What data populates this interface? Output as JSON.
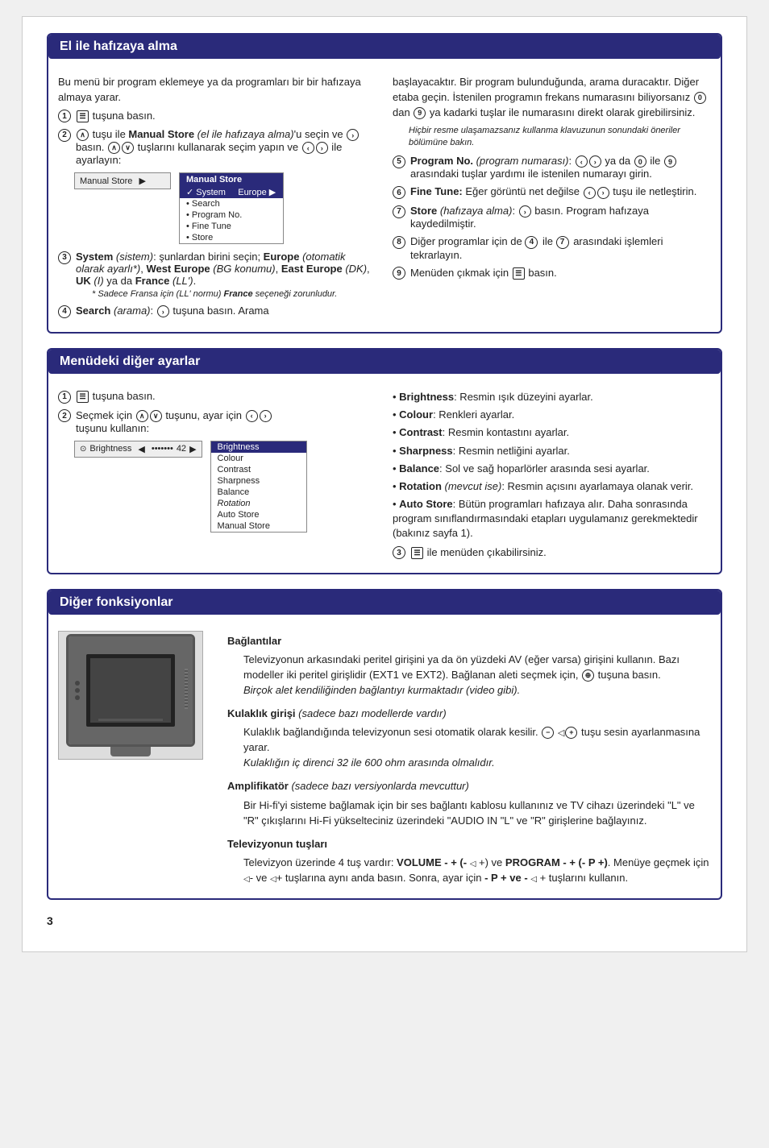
{
  "page": {
    "number": "3",
    "sections": {
      "section1": {
        "title": "El ile hafızaya alma",
        "col_left": {
          "intro": "Bu menü bir program eklemeye ya da programları bir bir hafızaya almaya yarar.",
          "step1": "tuşuna basın.",
          "step2_main": "tuşu ile Manual Store (el ile hafızaya alma)'u seçin ve",
          "step2_b": "basın.",
          "step2_c": "tuşlarını kullanarak seçim yapın ve",
          "step2_d": "ile ayarlayın:",
          "step3_main": "System (sistem):",
          "step3_options": "şunlardan birini seçin; Europe (otomatik olarak ayarlı*), West Europe (BG konumu), East Europe (DK), UK (I) ya da France (LL').",
          "step3_footnote": "* Sadece Fransa için (LL' normu) France seçeneği zorunludur.",
          "step4_main": "Search (arama):",
          "step4_detail": "tuşuna basın. Arama"
        },
        "col_right": {
          "para1": "başlayacaktır. Bir program bulunduğunda, arama duracaktır. Diğer etaba geçin. İstenilen programın frekans numarasını biliyorsanız",
          "para1b": "dan",
          "para1c": "ya kadarki tuşlar ile numarasını direkt olarak girebilirsiniz.",
          "para1_footnote": "Hiçbir resme ulaşamazsanız kullanma klavuzunun sonundaki öneriler bölümüne bakın.",
          "step5_main": "Program No. (program numarası):",
          "step5_detail": "ya da",
          "step5_detail2": "ile",
          "step5_detail3": "arasındaki tuşlar yardımı ile istenilen numarayı girin.",
          "step6_main": "Fine Tune:",
          "step6_detail": "Eğer görüntü net değilse",
          "step6_detail2": "tuşu ile netleştirin.",
          "step7_main": "Store (hafızaya alma):",
          "step7_detail": "basın. Program hafızaya kaydedilmiştir.",
          "step8_main": "Diğer programlar için de",
          "step8_detail": "ile",
          "step8_detail2": "arasındaki işlemleri tekrarlayın.",
          "step9_main": "Menüden çıkmak için",
          "step9_detail": "basın."
        },
        "menu": {
          "left_label": "Manual Store",
          "items": [
            "Manual Store",
            "✓ System",
            "• Search",
            "• Program No.",
            "• Fine Tune",
            "• Store"
          ],
          "system_value": "Europe ▶"
        }
      },
      "section2": {
        "title": "Menüdeki diğer ayarlar",
        "col_left": {
          "step1": "tuşuna basın.",
          "step2_main": "Seçmek için",
          "step2_detail": "tuşunu, ayar için",
          "step2_detail2": "tuşunu kullanın:"
        },
        "col_right": {
          "items": [
            "Brightness: Resmin ışık düzeyini ayarlar.",
            "Colour: Renkleri ayarlar.",
            "Contrast: Resmin kontastını ayarlar.",
            "Sharpness: Resmin netliğini ayarlar.",
            "Balance: Sol ve sağ hoparlörler arasında sesi ayarlar.",
            "Rotation (mevcut ise): Resmin açısını ayarlamaya olanak verir.",
            "Auto Store: Bütün programları hafızaya alır. Daha sonrasında program sınıflandırmasındaki etapları uygulamanız gerekmektedir (bakınız sayfa 1).",
            "ile menüden çıkabilirsiniz."
          ],
          "item_labels": [
            "Brightness",
            "Colour",
            "Contrast",
            "Sharpness",
            "Balance",
            "Rotation (mevcut ise)",
            "Auto Store"
          ],
          "item_details": [
            "Resmin ışık düzeyini ayarlar.",
            "Renkleri ayarlar.",
            "Resmin kontastını ayarlar.",
            "Resmin netliğini ayarlar.",
            "Sol ve sağ hoparlörler arasında sesi ayarlar.",
            "Resmin açısını ayarlamaya olanak verir.",
            "Bütün programları hafızaya alır. Daha sonrasında program sınıflandırmasındaki etapları uygulamanız gerekmektedir (bakınız sayfa 1)."
          ],
          "step3": "ile menüden çıkabilirsiniz."
        },
        "menu": {
          "left_label": "Brightness",
          "left_value": "42",
          "items": [
            "Brightness",
            "Colour",
            "Contrast",
            "Sharpness",
            "Balance",
            "Rotation",
            "Auto Store",
            "Manual Store"
          ]
        }
      },
      "section3": {
        "title": "Diğer fonksiyonlar",
        "baglantilar": {
          "title": "Bağlantılar",
          "text": "Televizyonun arkasındaki peritel girişini ya da ön yüzdeki AV (eğer varsa) girişini kullanın. Bazı modeller iki peritel girişlidir (EXT1 ve EXT2). Bağlanan aleti seçmek için,",
          "text2": "tuşuna basın.",
          "footnote": "Birçok alet kendiliğinden bağlantıyı kurmaktadır (video gibi)."
        },
        "kulaklik": {
          "title": "Kulaklık girişi",
          "title_italic": "(sadece bazı modellerde vardır)",
          "text": "Kulaklık bağlandığında televizyonun sesi otomatik olarak kesilir.",
          "text2": "tuşu sesin ayarlanmasına yarar.",
          "footnote": "Kulaklığın iç direnci 32 ile 600 ohm arasında olmalıdır."
        },
        "amplifikator": {
          "title": "Amplifikatör",
          "title_italic": "(sadece bazı versiyonlarda mevcuttur)",
          "text": "Bir Hi-fi'yi sisteme bağlamak için bir ses bağlantı kablosu kullanınız ve TV cihazı üzerindeki \"L\" ve \"R\" çıkışlarını Hi-Fi yükselteciniz üzerindeki \"AUDIO IN \"L\" ve \"R\" girişlerine bağlayınız."
        },
        "televizyon_tuslari": {
          "title": "Televizyonun tuşları",
          "text": "Televizyon üzerinde 4 tuş vardır: VOLUME - + (-",
          "text2": "+) ve PROGRAM - + (- P +). Menüye geçmek için",
          "text3": "- ve",
          "text4": "+ tuşlarına aynı anda basın. Sonra, ayar için - P + ve -",
          "text5": "+ tuşlarını kullanın."
        }
      }
    }
  }
}
